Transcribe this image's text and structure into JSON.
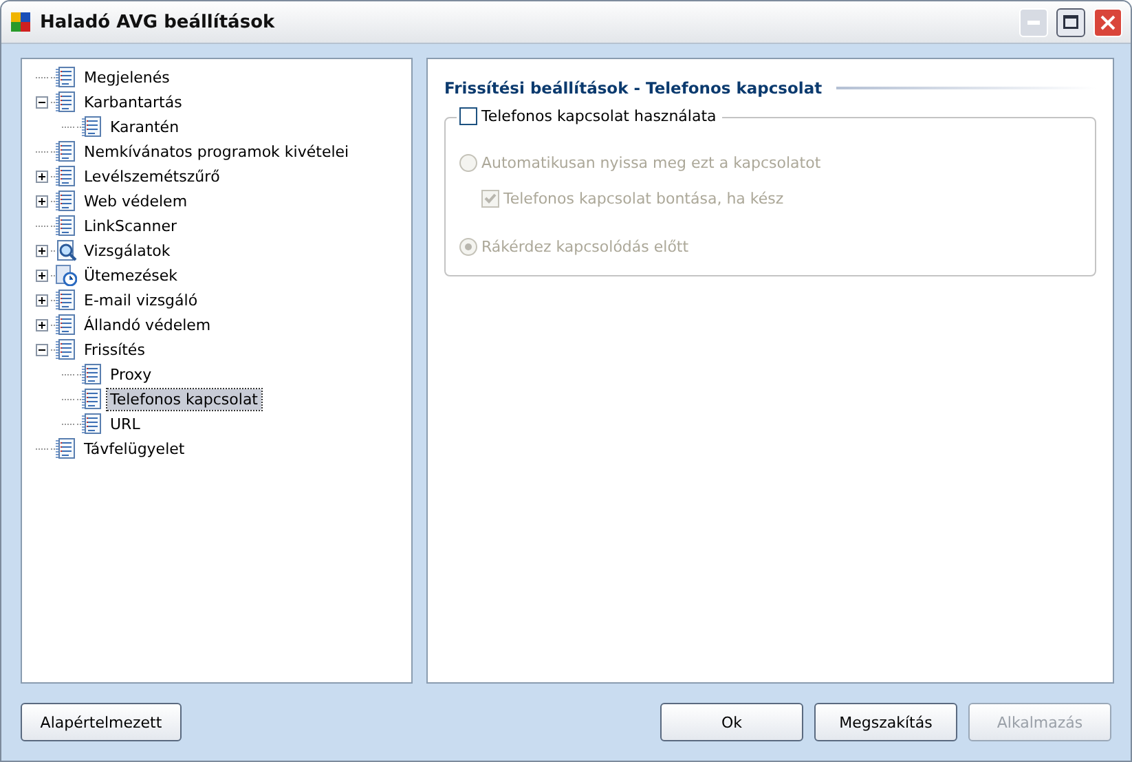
{
  "window": {
    "title": "Haladó AVG beállítások"
  },
  "tree": [
    {
      "label": "Megjelenés",
      "kind": "page",
      "selected": false
    },
    {
      "label": "Karbantartás",
      "kind": "page",
      "selected": false,
      "expanded": true,
      "children": [
        {
          "label": "Karantén",
          "kind": "page",
          "selected": false
        }
      ]
    },
    {
      "label": "Nemkívánatos programok kivételei",
      "kind": "page",
      "selected": false
    },
    {
      "label": "Levélszemétszűrő",
      "kind": "page",
      "selected": false,
      "expanded": false
    },
    {
      "label": "Web védelem",
      "kind": "page",
      "selected": false,
      "expanded": false
    },
    {
      "label": "LinkScanner",
      "kind": "page",
      "selected": false
    },
    {
      "label": "Vizsgálatok",
      "kind": "scan",
      "selected": false,
      "expanded": false
    },
    {
      "label": "Ütemezések",
      "kind": "schedule",
      "selected": false,
      "expanded": false
    },
    {
      "label": "E-mail vizsgáló",
      "kind": "page",
      "selected": false,
      "expanded": false
    },
    {
      "label": "Állandó védelem",
      "kind": "page",
      "selected": false,
      "expanded": false
    },
    {
      "label": "Frissítés",
      "kind": "page",
      "selected": false,
      "expanded": true,
      "children": [
        {
          "label": "Proxy",
          "kind": "page",
          "selected": false
        },
        {
          "label": "Telefonos kapcsolat",
          "kind": "page",
          "selected": true
        },
        {
          "label": "URL",
          "kind": "page",
          "selected": false
        }
      ]
    },
    {
      "label": "Távfelügyelet",
      "kind": "page",
      "selected": false
    }
  ],
  "panel": {
    "heading": "Frissítési beállítások - Telefonos kapcsolat",
    "group": {
      "label": "Telefonos kapcsolat használata",
      "checked": false
    },
    "options": [
      {
        "kind": "radio",
        "label": "Automatikusan nyissa meg ezt a kapcsolatot",
        "selected": false,
        "disabled": true,
        "children": [
          {
            "kind": "checkbox",
            "label": "Telefonos kapcsolat bontása, ha kész",
            "checked": true,
            "disabled": true
          }
        ]
      },
      {
        "kind": "radio",
        "label": "Rákérdez kapcsolódás előtt",
        "selected": true,
        "disabled": true
      }
    ]
  },
  "buttons_left": [
    {
      "label": "Alapértelmezett",
      "disabled": false
    }
  ],
  "buttons_right": [
    {
      "label": "Ok",
      "disabled": false
    },
    {
      "label": "Megszakítás",
      "disabled": false
    },
    {
      "label": "Alkalmazás",
      "disabled": true
    }
  ]
}
